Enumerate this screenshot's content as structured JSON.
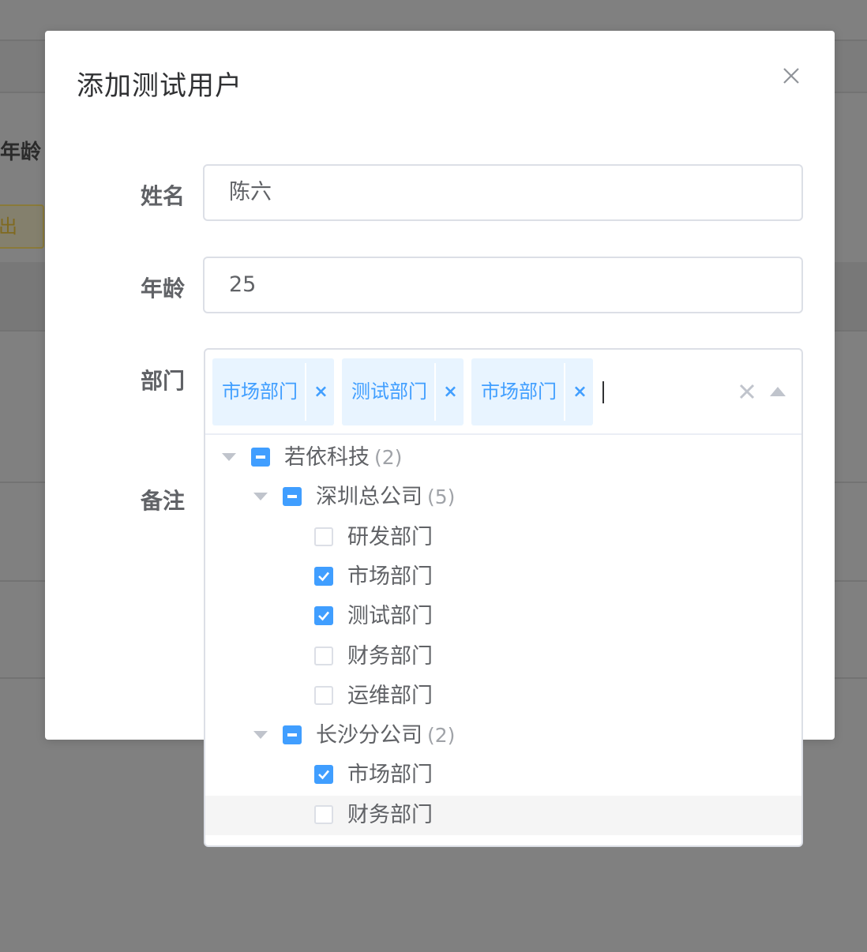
{
  "background": {
    "age_label": "年龄",
    "export_label": "导出"
  },
  "dialog": {
    "title": "添加测试用户"
  },
  "form": {
    "name_label": "姓名",
    "name_value": "陈六",
    "age_label": "年龄",
    "age_value": "25",
    "department_label": "部门",
    "remark_label": "备注"
  },
  "department_select": {
    "selected_tags": [
      {
        "label": "市场部门"
      },
      {
        "label": "测试部门"
      },
      {
        "label": "市场部门"
      }
    ],
    "remove_symbol": "×",
    "tree": [
      {
        "label": "若依科技",
        "count": "(2)",
        "state": "partial",
        "expanded": true,
        "level": 0
      },
      {
        "label": "深圳总公司",
        "count": "(5)",
        "state": "partial",
        "expanded": true,
        "level": 1
      },
      {
        "label": "研发部门",
        "count": "",
        "state": "unchecked",
        "level": 2
      },
      {
        "label": "市场部门",
        "count": "",
        "state": "checked",
        "level": 2
      },
      {
        "label": "测试部门",
        "count": "",
        "state": "checked",
        "level": 2
      },
      {
        "label": "财务部门",
        "count": "",
        "state": "unchecked",
        "level": 2
      },
      {
        "label": "运维部门",
        "count": "",
        "state": "unchecked",
        "level": 2
      },
      {
        "label": "长沙分公司",
        "count": "(2)",
        "state": "partial",
        "expanded": true,
        "level": 1
      },
      {
        "label": "市场部门",
        "count": "",
        "state": "checked",
        "level": 2
      },
      {
        "label": "财务部门",
        "count": "",
        "state": "unchecked",
        "level": 2,
        "hover": true
      }
    ]
  },
  "colors": {
    "primary": "#409eff",
    "tag_background": "#e8f4ff",
    "border": "#dcdfe6",
    "overlay": "#808080"
  }
}
